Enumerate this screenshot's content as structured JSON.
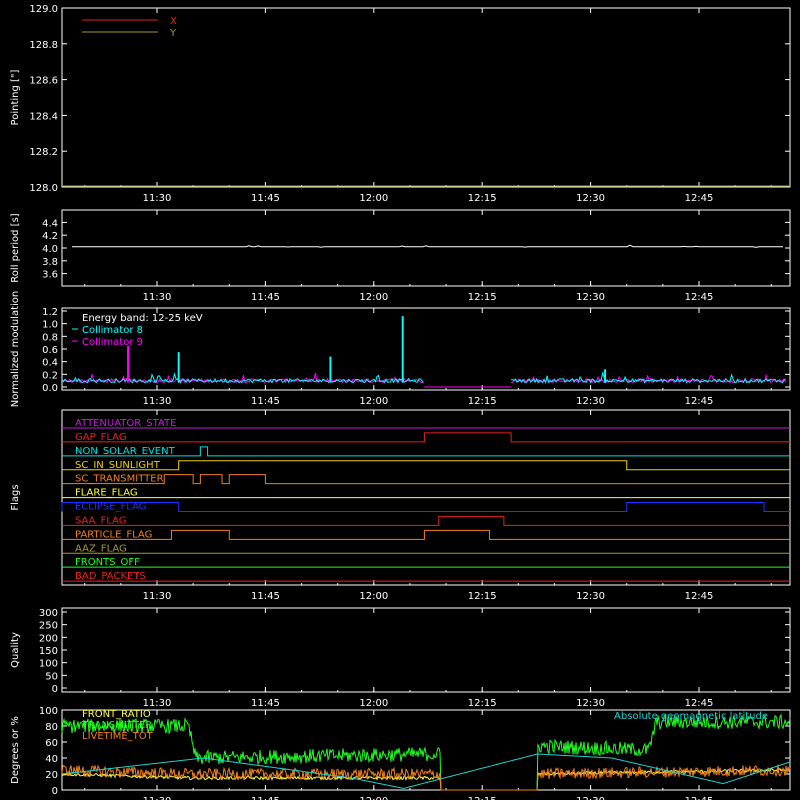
{
  "chart_data": [
    {
      "type": "line",
      "ylabel": "Pointing [\"]",
      "ylim": [
        128.0,
        129.0
      ],
      "yticks": [
        "128.0",
        "128.2",
        "128.4",
        "128.6",
        "128.8",
        "129.0"
      ],
      "xticks": [
        "11:30",
        "11:45",
        "12:00",
        "12:15",
        "12:30",
        "12:45"
      ],
      "legend_position": "top-left",
      "series": [
        {
          "name": "X",
          "color": "#e8221c",
          "values": []
        },
        {
          "name": "Y",
          "color": "#a39a3a",
          "values": []
        }
      ]
    },
    {
      "type": "line",
      "ylabel": "Roll period [s]",
      "ylim": [
        3.5,
        4.5
      ],
      "yticks": [
        "3.6",
        "3.8",
        "4.0",
        "4.2",
        "4.4"
      ],
      "xticks": [
        "11:30",
        "11:45",
        "12:00",
        "12:15",
        "12:30",
        "12:45"
      ],
      "series": [
        {
          "color": "#ffffff",
          "x": [
            "11:16",
            "12:54"
          ],
          "values": [
            4.02,
            4.02
          ]
        }
      ]
    },
    {
      "type": "line",
      "ylabel": "Normalized modulation",
      "ylim": [
        0.0,
        1.2
      ],
      "yticks": [
        "0.0",
        "0.2",
        "0.4",
        "0.6",
        "0.8",
        "1.0",
        "1.2"
      ],
      "xticks": [
        "11:30",
        "11:45",
        "12:00",
        "12:15",
        "12:30",
        "12:45"
      ],
      "legend_position": "top-left",
      "legend_title": "Energy band: 12-25 keV",
      "series": [
        {
          "name": "Collimator 8",
          "color": "#00ffff",
          "spikes": [
            [
              "11:33",
              0.55
            ],
            [
              "11:54",
              0.48
            ],
            [
              "12:04",
              1.12
            ],
            [
              "12:32",
              0.28
            ]
          ]
        },
        {
          "name": "Collimator 9",
          "color": "#ff00ff",
          "spikes": [
            [
              "11:26",
              0.65
            ]
          ]
        }
      ]
    },
    {
      "type": "line",
      "ylabel": "Flags",
      "xticks": [
        "11:30",
        "11:45",
        "12:00",
        "12:15",
        "12:30",
        "12:45"
      ],
      "flags": [
        {
          "name": "ATTENUATOR_STATE",
          "color": "#c020d8",
          "on": []
        },
        {
          "name": "GAP_FLAG",
          "color": "#e8221c",
          "on": [
            [
              "12:07",
              "12:19"
            ]
          ]
        },
        {
          "name": "NON_SOLAR_EVENT",
          "color": "#00e0e0",
          "on": [
            [
              "11:36",
              "11:37"
            ]
          ]
        },
        {
          "name": "SC_IN_SUNLIGHT",
          "color": "#f0d000",
          "on": [
            [
              "11:33",
              "12:35"
            ]
          ]
        },
        {
          "name": "SC_TRANSMITTER",
          "color": "#f08020",
          "on": [
            [
              "11:31",
              "11:35"
            ],
            [
              "11:36",
              "11:39"
            ],
            [
              "11:40",
              "11:45"
            ]
          ]
        },
        {
          "name": "FLARE_FLAG",
          "color": "#ffff40",
          "on": []
        },
        {
          "name": "ECLIPSE_FLAG",
          "color": "#2030ff",
          "on": [
            [
              "11:16",
              "11:33"
            ],
            [
              "12:35",
              "12:54"
            ]
          ]
        },
        {
          "name": "SAA_FLAG",
          "color": "#e8221c",
          "on": [
            [
              "12:09",
              "12:18"
            ]
          ]
        },
        {
          "name": "PARTICLE_FLAG",
          "color": "#f08020",
          "on": [
            [
              "11:32",
              "11:40"
            ],
            [
              "12:07",
              "12:16"
            ]
          ]
        },
        {
          "name": "AAZ_FLAG",
          "color": "#a39a3a",
          "on": []
        },
        {
          "name": "FRONTS_OFF",
          "color": "#20ff20",
          "on": []
        },
        {
          "name": "BAD_PACKETS",
          "color": "#e8221c",
          "on": []
        }
      ]
    },
    {
      "type": "line",
      "ylabel": "Quality",
      "ylim": [
        0,
        300
      ],
      "yticks": [
        "0",
        "50",
        "100",
        "150",
        "200",
        "250",
        "300"
      ],
      "xticks": [
        "11:30",
        "11:45",
        "12:00",
        "12:15",
        "12:30",
        "12:45"
      ],
      "series": []
    },
    {
      "type": "line",
      "ylabel": "Degrees or %",
      "ylim": [
        0,
        100
      ],
      "yticks": [
        "0",
        "20",
        "40",
        "60",
        "80",
        "100"
      ],
      "xticks": [
        "11:30",
        "11:45",
        "12:00",
        "12:15",
        "12:30",
        "12:45"
      ],
      "series": [
        {
          "name": "FRONT_RATIO",
          "color": "#ffff40",
          "typical": [
            [
              "11:16",
              20
            ],
            [
              "11:33",
              15
            ],
            [
              "12:07",
              15
            ],
            [
              "12:20",
              20
            ],
            [
              "12:54",
              25
            ]
          ]
        },
        {
          "name": "TRANSMITTER",
          "color": "#20ff20",
          "typical": [
            [
              "11:16",
              80
            ],
            [
              "11:33",
              80
            ],
            [
              "11:34",
              40
            ],
            [
              "12:07",
              45
            ],
            [
              "12:20",
              55
            ],
            [
              "12:35",
              50
            ],
            [
              "12:36",
              85
            ],
            [
              "12:54",
              85
            ]
          ]
        },
        {
          "name": "LIVETIME_TOT",
          "color": "#f08020",
          "typical": [
            [
              "11:16",
              25
            ],
            [
              "11:33",
              20
            ],
            [
              "12:07",
              20
            ],
            [
              "12:20",
              20
            ],
            [
              "12:54",
              25
            ]
          ]
        },
        {
          "name": "Absolute geomagnetic latitude",
          "color": "#20d0d0",
          "typical": [
            [
              "11:16",
              20
            ],
            [
              "11:35",
              40
            ],
            [
              "11:55",
              15
            ],
            [
              "12:02",
              2
            ],
            [
              "12:20",
              45
            ],
            [
              "12:30",
              40
            ],
            [
              "12:45",
              8
            ],
            [
              "12:54",
              35
            ]
          ]
        }
      ]
    }
  ]
}
